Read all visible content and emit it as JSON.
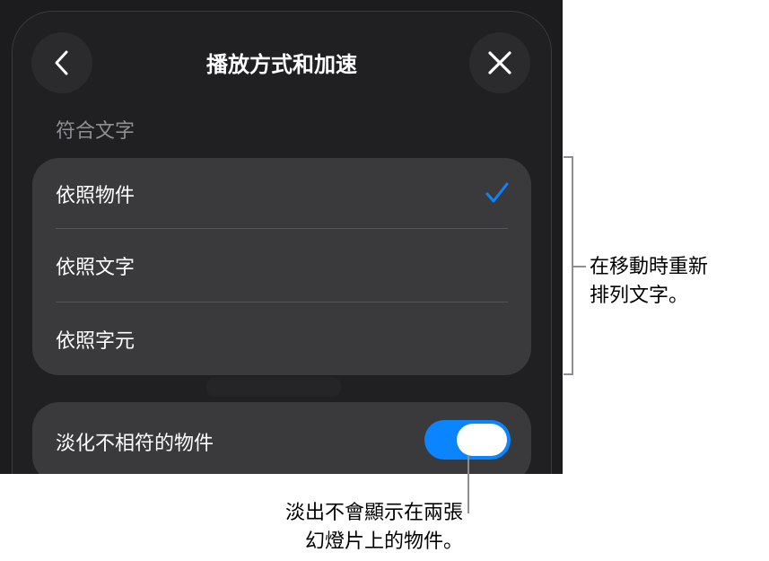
{
  "header": {
    "title": "播放方式和加速",
    "back_icon": "chevron-left-icon",
    "close_icon": "close-icon"
  },
  "section": {
    "label": "符合文字"
  },
  "match_options": [
    {
      "label": "依照物件",
      "selected": true
    },
    {
      "label": "依照文字",
      "selected": false
    },
    {
      "label": "依照字元",
      "selected": false
    }
  ],
  "fade_unmatched": {
    "label": "淡化不相符的物件",
    "on": true
  },
  "callouts": {
    "right_line1": "在移動時重新",
    "right_line2": "排列文字。",
    "bottom_line1": "淡出不會顯示在兩張",
    "bottom_line2": "幻燈片上的物件。"
  },
  "colors": {
    "accent": "#0a84ff",
    "background": "#1c1c1e",
    "group": "#3a3a3c"
  }
}
